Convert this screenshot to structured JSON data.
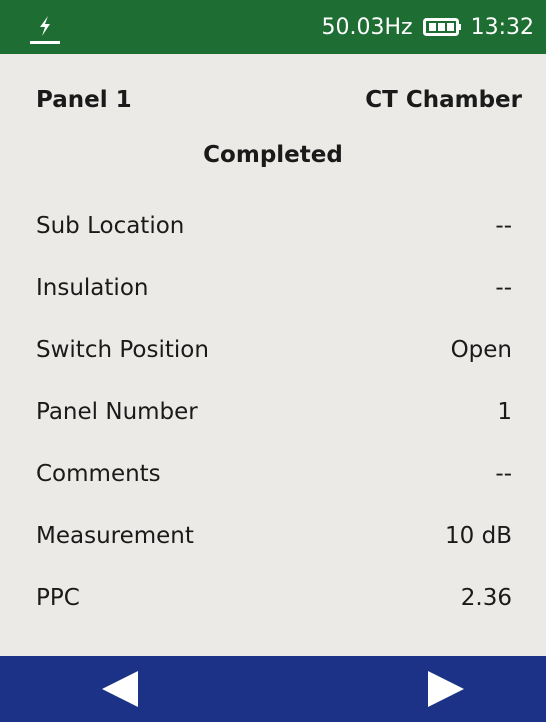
{
  "status_bar": {
    "frequency": "50.03Hz",
    "time": "13:32",
    "app_icon": "flash-icon",
    "battery_icon": "battery-icon",
    "bg_color": "#1E6E34"
  },
  "header": {
    "location": "Panel 1",
    "equipment": "CT Chamber",
    "status": "Completed"
  },
  "fields": [
    {
      "label": "Sub Location",
      "value": "--"
    },
    {
      "label": "Insulation",
      "value": "--"
    },
    {
      "label": "Switch Position",
      "value": "Open"
    },
    {
      "label": "Panel Number",
      "value": "1"
    },
    {
      "label": "Comments",
      "value": "--"
    },
    {
      "label": "Measurement",
      "value": "10 dB"
    },
    {
      "label": "PPC",
      "value": "2.36"
    }
  ],
  "nav": {
    "prev_icon": "triangle-left-icon",
    "next_icon": "triangle-right-icon",
    "bg_color": "#1C3286"
  }
}
